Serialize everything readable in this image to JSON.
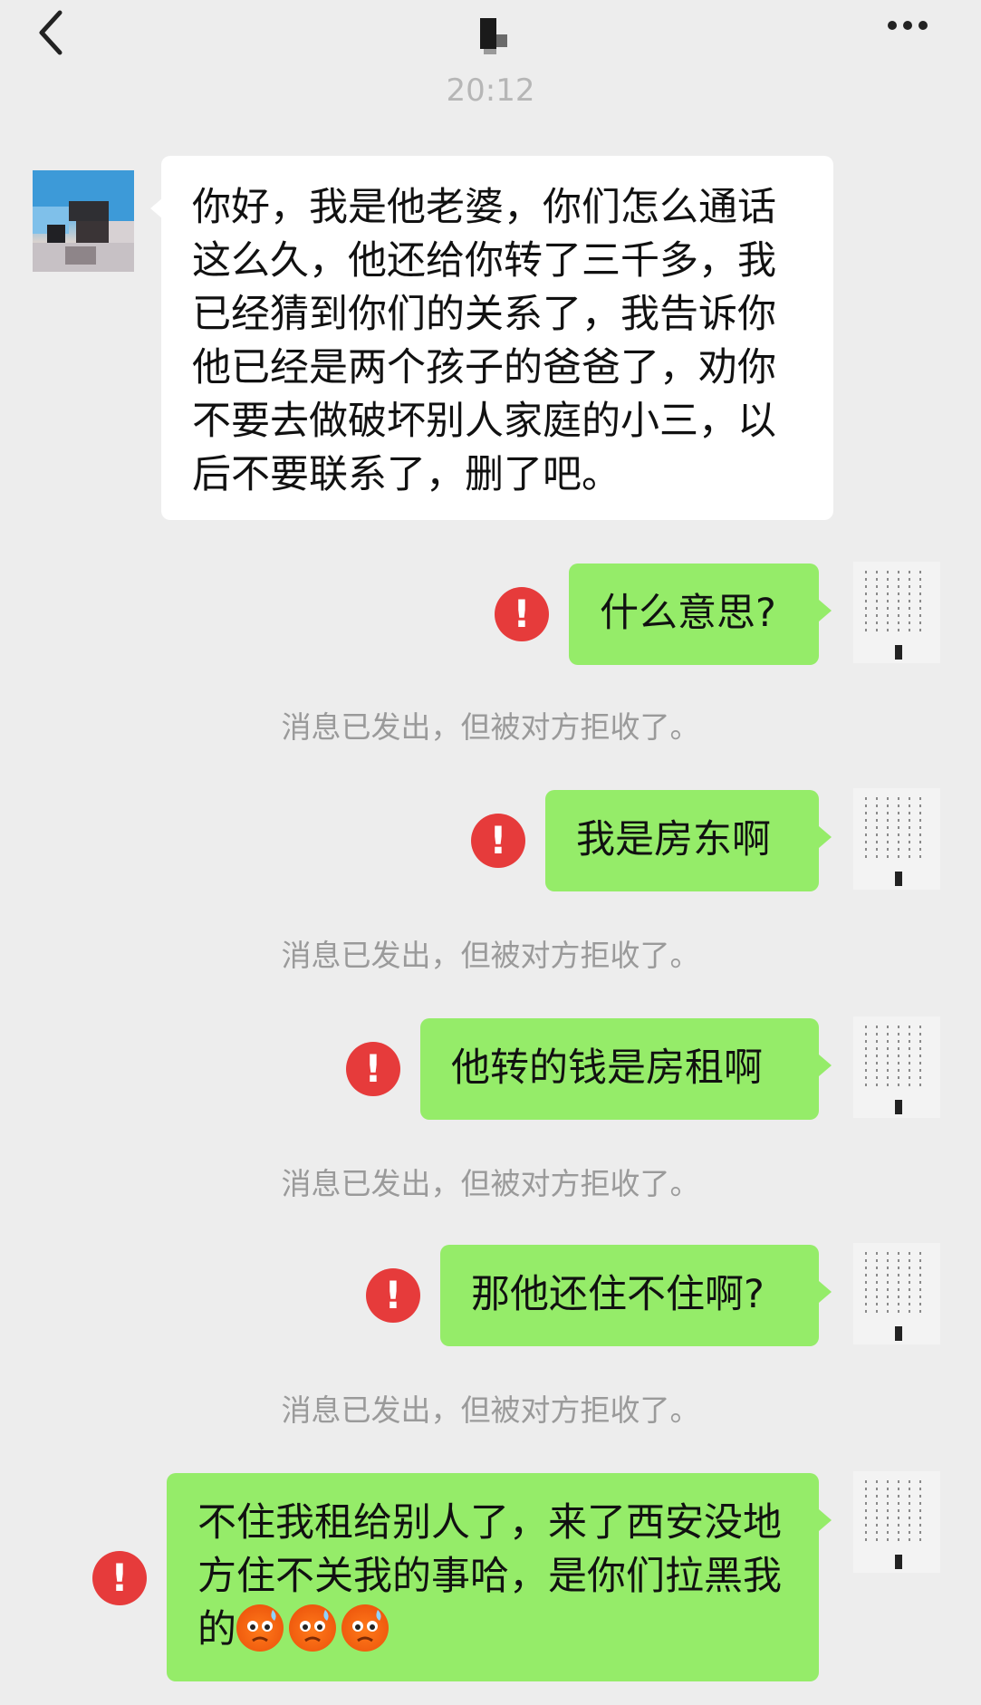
{
  "header": {
    "time": "20:12"
  },
  "messages": [
    {
      "side": "left",
      "text": "你好，我是他老婆，你们怎么通话这么久，他还给你转了三千多，我已经猜到你们的关系了，我告诉你他已经是两个孩子的爸爸了，劝你不要去做破坏别人家庭的小三，以后不要联系了，删了吧。"
    },
    {
      "side": "right",
      "text": "什么意思?",
      "status": "消息已发出，但被对方拒收了。"
    },
    {
      "side": "right",
      "text": "我是房东啊",
      "status": "消息已发出，但被对方拒收了。"
    },
    {
      "side": "right",
      "text": "他转的钱是房租啊",
      "status": "消息已发出，但被对方拒收了。"
    },
    {
      "side": "right",
      "text": "那他还住不住啊?",
      "status": "消息已发出，但被对方拒收了。"
    },
    {
      "side": "right",
      "text": "不住我租给别人了，来了西安没地方住不关我的事哈，是你们拉黑我的",
      "emoji": [
        "cold-sweat-emoji",
        "cold-sweat-emoji",
        "cold-sweat-emoji"
      ]
    }
  ],
  "icons": {
    "back": "chevron-left-icon",
    "menu": "more-dots-icon",
    "error": "exclamation-circle-icon"
  },
  "error_glyph": "!",
  "colors": {
    "background": "#ededed",
    "sent_bubble": "#95ec69",
    "received_bubble": "#ffffff",
    "error": "#e63b3b",
    "system_text": "#9a9a9a"
  }
}
